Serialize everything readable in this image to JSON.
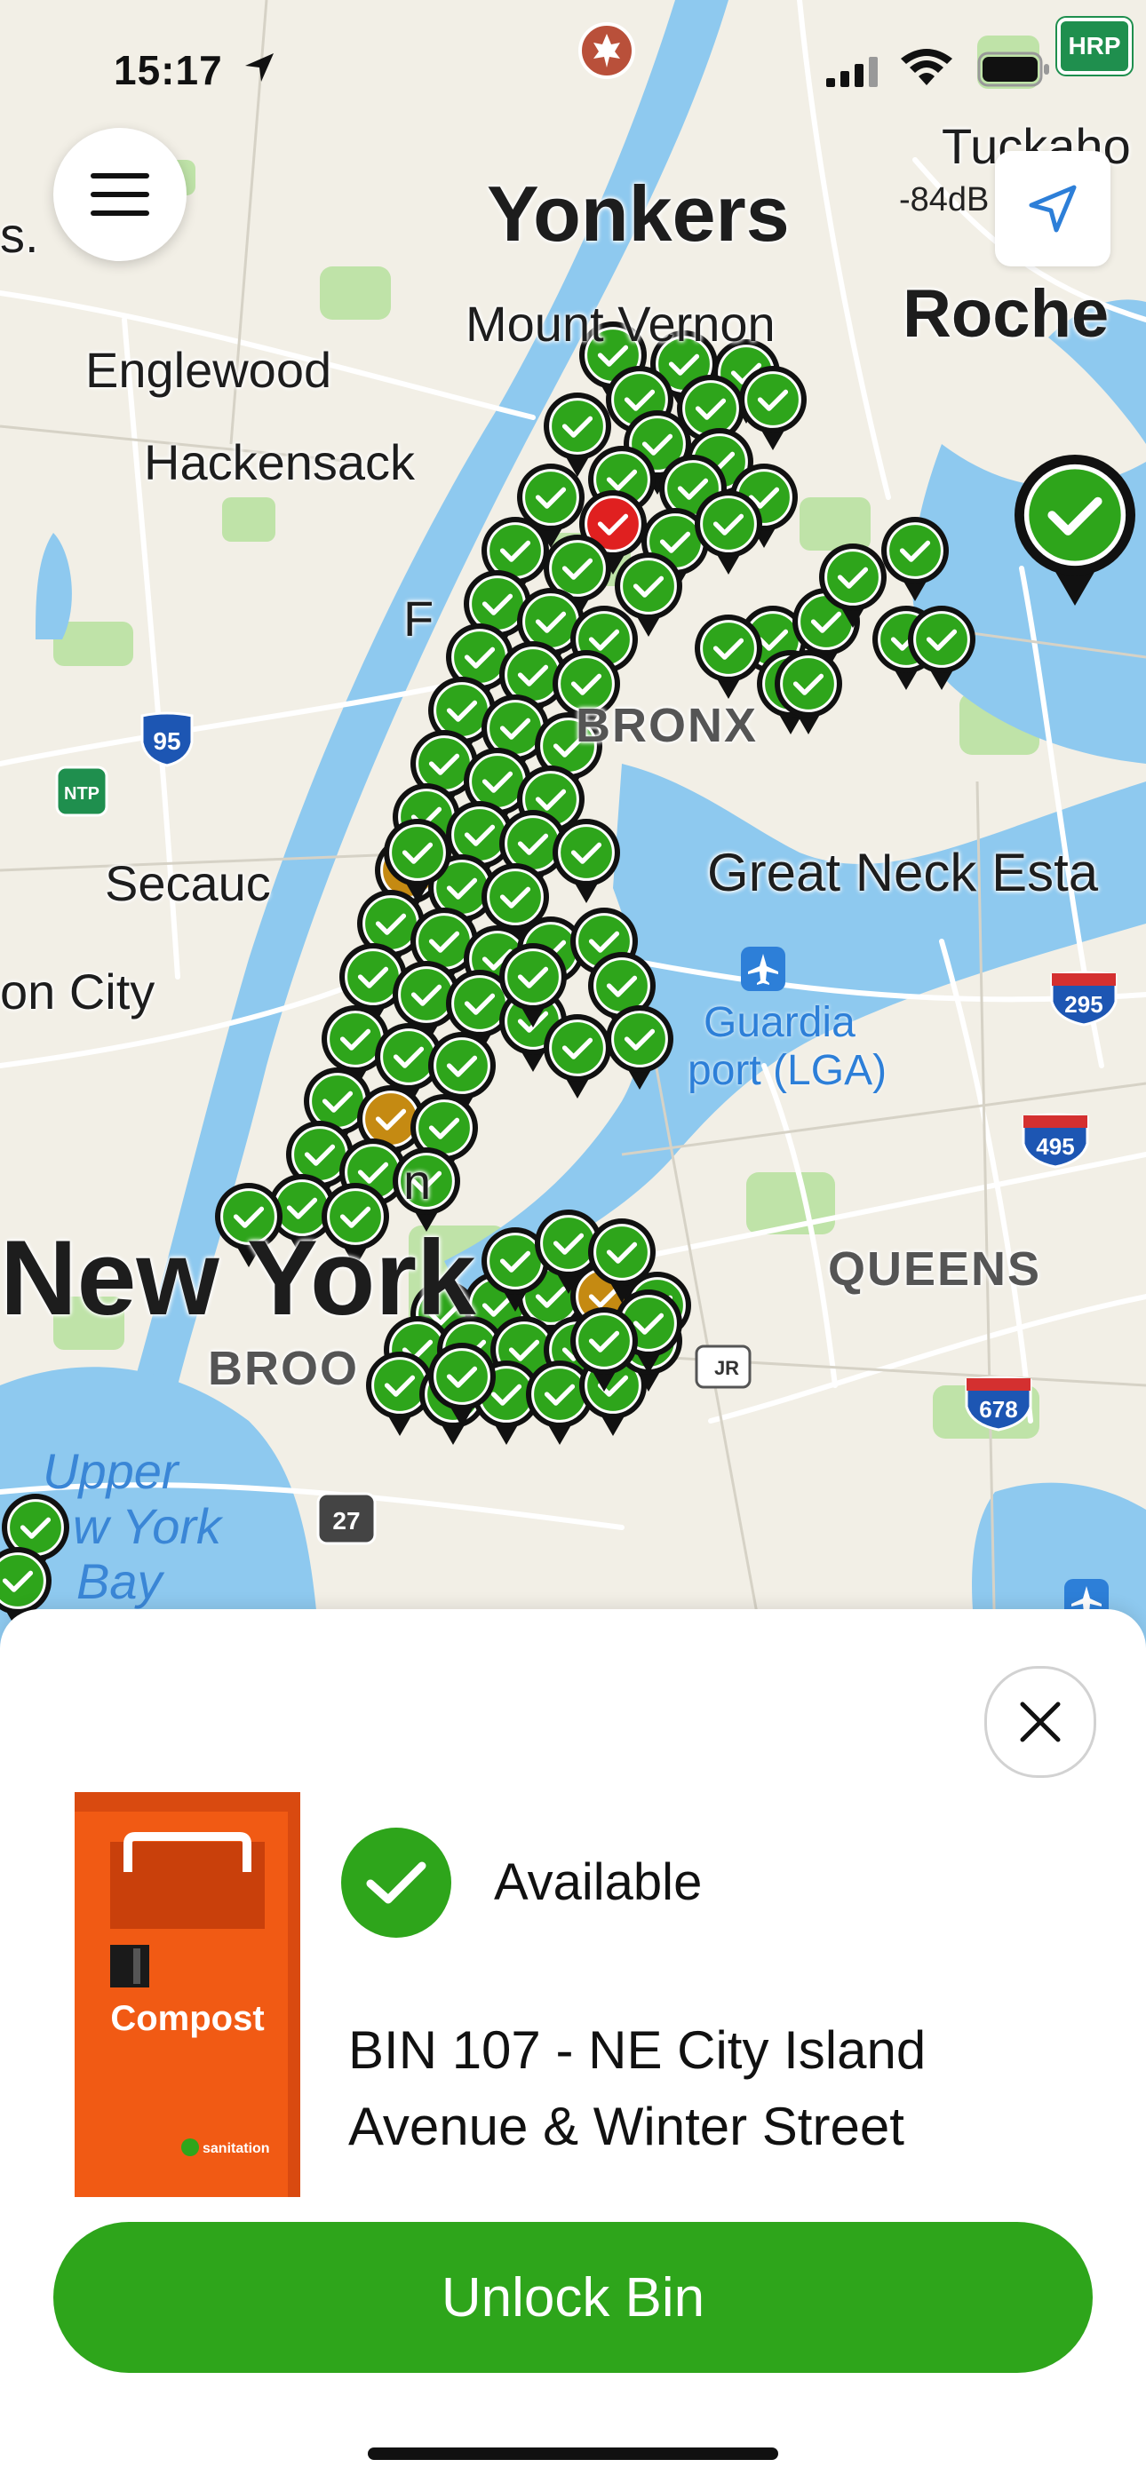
{
  "status_bar": {
    "time": "15:17",
    "badge": "HRP"
  },
  "map": {
    "signal_readout": "-84dB",
    "labels": {
      "yonkers": "Yonkers",
      "mount_vernon": "Mount Vernon",
      "tuckahoe": "Tuckaho",
      "rochelle": "Roche",
      "englewood": "Englewood",
      "hackensack": "Hackensack",
      "f_partial": "F",
      "bronx": "BRONX",
      "secaucus": "Secauc",
      "jersey_city": "on City",
      "great_neck": "Great Neck Esta",
      "laguardia_1": "Guardia",
      "laguardia_2": "port (LGA)",
      "new_york": "New York",
      "queens": "QUEENS",
      "brooklyn": "BROO",
      "upper_bay_1": "Upper",
      "upper_bay_2": "w York",
      "upper_bay_3": "Bay",
      "s_partial": "s.",
      "n_partial": "n"
    },
    "shields": {
      "i95": "95",
      "i295": "295",
      "i495": "495",
      "i678": "678",
      "r27": "27",
      "ntp": "NTP",
      "jr": "JR"
    },
    "colors": {
      "pin_available": "#2ea51b",
      "pin_unavailable": "#c58a12",
      "pin_error": "#e02020",
      "water": "#8ec9ef",
      "park": "#bfe3a8"
    }
  },
  "sheet": {
    "status_text": "Available",
    "address": "BIN 107 - NE City Island Avenue & Winter Street",
    "unlock_label": "Unlock Bin",
    "bin_image": {
      "label": "Compost",
      "brand": "sanitation",
      "color": "#f15a14"
    }
  }
}
